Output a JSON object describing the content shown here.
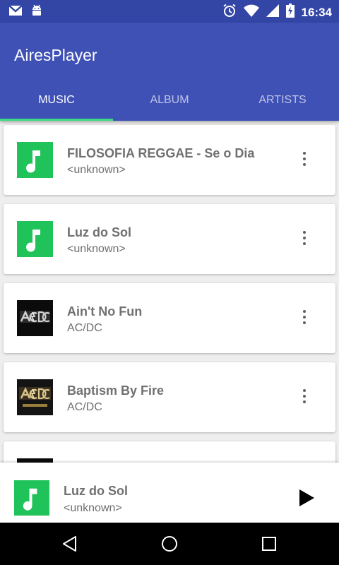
{
  "status_bar": {
    "time": "16:34",
    "icons": [
      "gmail-icon",
      "android-icon",
      "alarm-icon",
      "wifi-icon",
      "signal-icon",
      "battery-charging-icon"
    ]
  },
  "app": {
    "title": "AiresPlayer"
  },
  "tabs": [
    {
      "label": "MUSIC",
      "active": true
    },
    {
      "label": "ALBUM",
      "active": false
    },
    {
      "label": "ARTISTS",
      "active": false
    }
  ],
  "songs": [
    {
      "title": "FILOSOFIA REGGAE - Se o Dia",
      "artist": "<unknown>",
      "art": "music-note"
    },
    {
      "title": "Luz do Sol",
      "artist": "<unknown>",
      "art": "music-note"
    },
    {
      "title": "Ain't No Fun",
      "artist": "AC/DC",
      "art": "acdc-album"
    },
    {
      "title": "Baptism By Fire",
      "artist": "AC/DC",
      "art": "acdc-album"
    }
  ],
  "now_playing": {
    "title": "Luz do Sol",
    "artist": "<unknown>",
    "art": "music-note"
  },
  "colors": {
    "primary": "#3f51b5",
    "primary_dark": "#3346a6",
    "accent": "#3ddc84",
    "note_tile": "#1fc35a"
  }
}
